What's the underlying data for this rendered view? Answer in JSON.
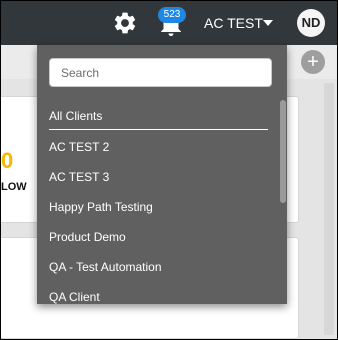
{
  "header": {
    "notification_count": "523",
    "client_name": "AC TEST",
    "user_initials": "ND",
    "icons": {
      "settings": "gear-icon",
      "notifications": "bell-icon",
      "client_menu": "caret-down-icon"
    }
  },
  "toolbar": {
    "add_label": "+",
    "add_icon": "plus-circle-icon"
  },
  "card": {
    "value": "0",
    "label": "LOW"
  },
  "client_dropdown": {
    "search_placeholder": "Search",
    "search_value": "",
    "options": [
      {
        "label": "All Clients"
      },
      {
        "label": "AC TEST 2"
      },
      {
        "label": "AC TEST 3"
      },
      {
        "label": "Happy Path Testing"
      },
      {
        "label": "Product Demo"
      },
      {
        "label": "QA - Test Automation"
      },
      {
        "label": "QA Client"
      }
    ]
  },
  "colors": {
    "header_bg": "#32373c",
    "dropdown_bg": "#606060",
    "badge_bg": "#1e88e5",
    "accent_yellow": "#f5b700"
  }
}
